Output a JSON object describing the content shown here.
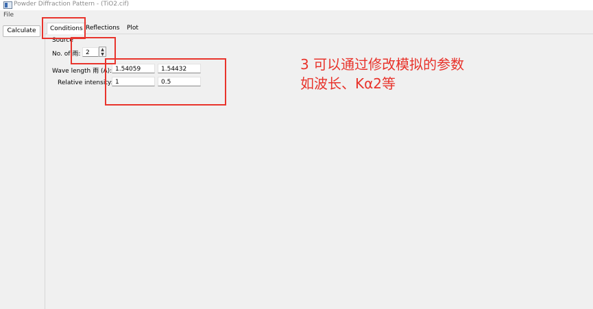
{
  "window": {
    "title": "Powder Diffraction Pattern - (TiO2.cif)"
  },
  "menu": {
    "file": "File"
  },
  "sidebar": {
    "calculate_label": "Calculate"
  },
  "tabs": [
    {
      "label": "Conditions",
      "active": true
    },
    {
      "label": "Reflections",
      "active": false
    },
    {
      "label": "Plot",
      "active": false
    }
  ],
  "conditions": {
    "source_label": "Source",
    "num_label": "No. of 雨:",
    "num_value": "2",
    "wavelength_label": "Wave length 雨 (A):",
    "wavelengths": [
      "1.54059",
      "1.54432"
    ],
    "relative_intensity_label": "Relative intensity:",
    "intensities": [
      "1",
      "0.5"
    ]
  },
  "annotation": {
    "line1": "3 可以通过修改模拟的参数",
    "line2": "如波长、Kα2等",
    "color": "#e8332b"
  }
}
